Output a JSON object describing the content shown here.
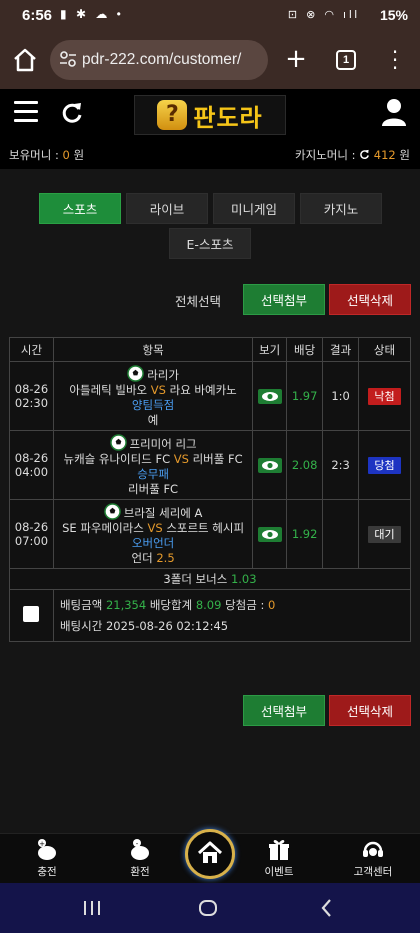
{
  "status_bar": {
    "time": "6:56",
    "battery": "15%"
  },
  "browser": {
    "url": "pdr-222.com/customer/",
    "tab_count": "1"
  },
  "site": {
    "logo_text": "판도라",
    "logo_badge": "?"
  },
  "money": {
    "bounce_label": "보유머니 :",
    "bounce_value": "0",
    "bounce_unit": "원",
    "casino_label": "카지노머니 :",
    "casino_value": "412",
    "casino_unit": "원"
  },
  "tabs": [
    "스포츠",
    "라이브",
    "미니게임",
    "카지노",
    "E-스포츠"
  ],
  "select_row": {
    "label": "전체선택",
    "add_label": "선택첨부",
    "delete_label": "선택삭제"
  },
  "table": {
    "headers": [
      "시간",
      "항목",
      "보기",
      "배당",
      "결과",
      "상태"
    ],
    "rows": [
      {
        "date": "08-26",
        "time": "02:30",
        "league": "라리가",
        "home": "아틀레틱 빌바오",
        "vs": "VS",
        "away": "라요 바예카노",
        "market": "양팀득점",
        "selection": "예",
        "odds": "1.97",
        "result": "1:0",
        "status": "낙첨",
        "status_type": "lose"
      },
      {
        "date": "08-26",
        "time": "04:00",
        "league": "프리미어 리그",
        "home": "뉴캐슬 유나이티드 FC",
        "vs": "VS",
        "away": "리버풀 FC",
        "market": "승무패",
        "selection": "리버풀 FC",
        "odds": "2.08",
        "result": "2:3",
        "status": "당첨",
        "status_type": "win"
      },
      {
        "date": "08-26",
        "time": "07:00",
        "league": "브라질 세리에 A",
        "home": "SE 파우메이라스",
        "vs": "VS",
        "away": "스포르트 헤시피",
        "market": "오버언더",
        "selection": "언더",
        "selection_value": "2.5",
        "odds": "1.92",
        "result": "",
        "status": "대기",
        "status_type": "wait"
      }
    ],
    "bonus": {
      "label": "3폴더 보너스",
      "value": "1.03"
    },
    "summary": {
      "amount_label": "배팅금액",
      "amount": "21,354",
      "total_label": "배당합계",
      "total": "8.09",
      "win_label": "당첨금 :",
      "win": "0",
      "time_label": "배팅시간",
      "time": "2025-08-26 02:12:45"
    }
  },
  "bottom_buttons": {
    "add_label": "선택첨부",
    "delete_label": "선택삭제"
  },
  "bottom_nav": [
    "충전",
    "환전",
    "이벤트",
    "고객센터"
  ],
  "colors": {
    "accent_green": "#1e7d33",
    "accent_red": "#9e1a1a",
    "odds_green": "#34b24a",
    "vs_orange": "#e59a2c",
    "pick_blue": "#4a9cf0",
    "status_lose": "#c21d1d",
    "status_win": "#1d34c2"
  }
}
